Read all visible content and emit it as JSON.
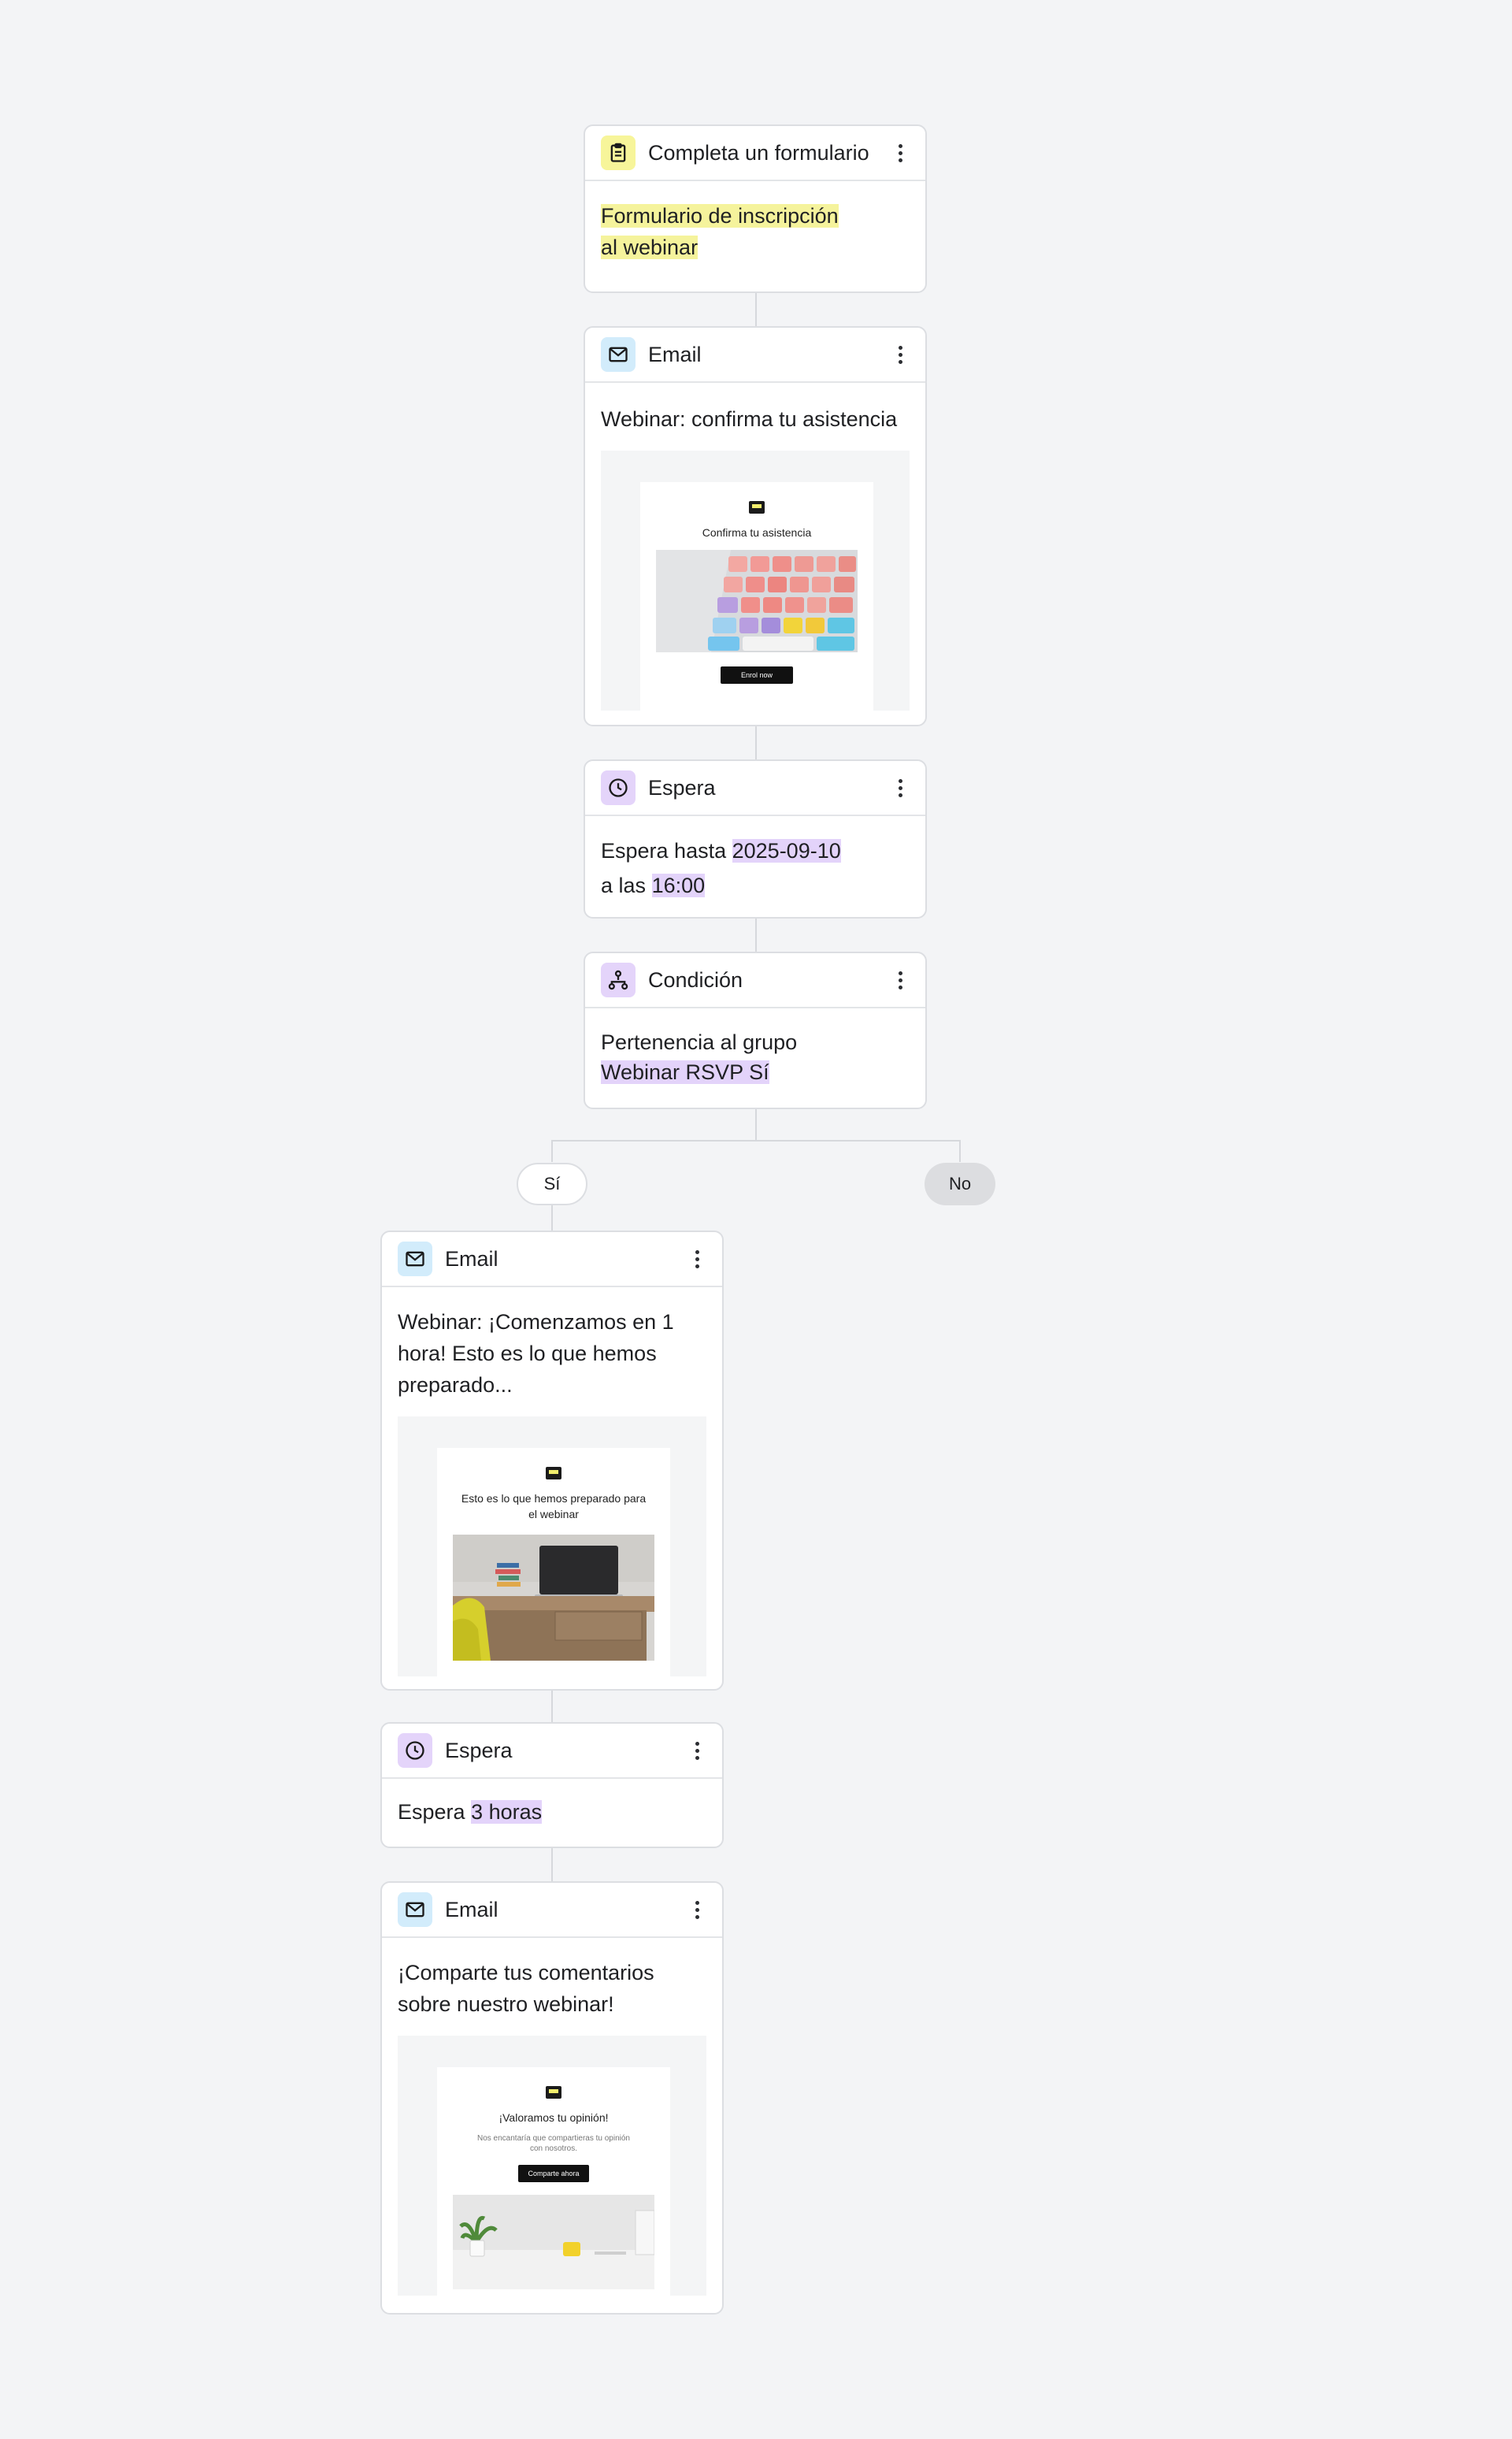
{
  "nodes": {
    "trigger": {
      "title": "Completa un formulario",
      "line1": "Formulario de inscripción",
      "line2": "al webinar"
    },
    "email1": {
      "title": "Email",
      "subject": "Webinar: confirma tu asistencia",
      "preview": {
        "heading": "Confirma tu asistencia",
        "button": "Enrol now"
      }
    },
    "wait1": {
      "title": "Espera",
      "prefix": "Espera hasta",
      "date": "2025-09-10",
      "mid": "a las",
      "time": "16:00"
    },
    "condition": {
      "title": "Condición",
      "line1": "Pertenencia al grupo",
      "group": "Webinar RSVP Sí"
    },
    "branch_yes": "Sí",
    "branch_no": "No",
    "email2": {
      "title": "Email",
      "subject": "Webinar: ¡Comenzamos en 1 hora! Esto es lo que hemos preparado...",
      "preview": {
        "heading": "Esto es lo que hemos preparado para el webinar"
      }
    },
    "wait2": {
      "title": "Espera",
      "prefix": "Espera",
      "duration": "3 horas"
    },
    "email3": {
      "title": "Email",
      "subject": "¡Comparte tus comentarios sobre nuestro webinar!",
      "preview": {
        "heading": "¡Valoramos tu opinión!",
        "body": "Nos encantaría que compartieras tu opinión con nosotros.",
        "button": "Comparte ahora"
      }
    }
  },
  "icons": {
    "trigger": "clipboard-icon",
    "email": "envelope-icon",
    "wait": "clock-icon",
    "condition": "branch-icon",
    "menu": "more-vertical-icon",
    "logo": "chat-logo-icon"
  },
  "colors": {
    "background": "#f3f4f6",
    "yellow_highlight": "#f5f39c",
    "purple_highlight": "#e3d3fa",
    "email_icon_bg": "#d2ecfb",
    "form_icon_bg": "#f7f59a"
  }
}
